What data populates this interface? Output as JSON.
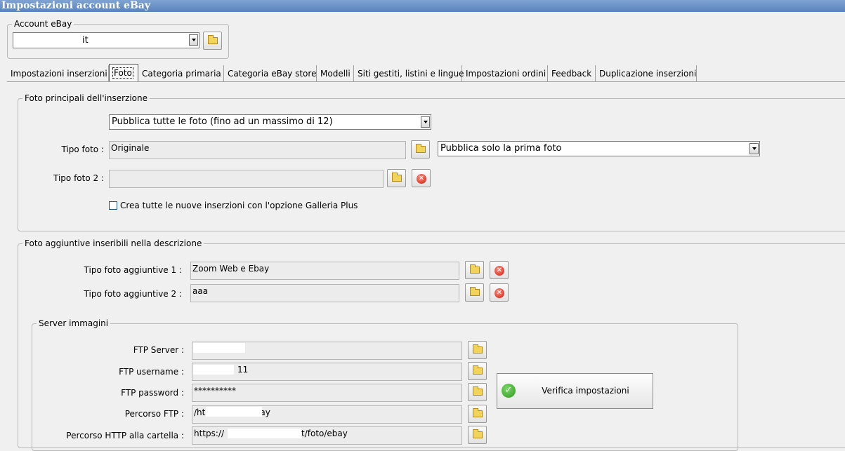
{
  "window": {
    "title": "Impostazioni account eBay"
  },
  "account": {
    "group_label": "Account eBay",
    "selected": "it"
  },
  "tabs": [
    {
      "label": "Impostazioni inserzioni"
    },
    {
      "label": "Foto"
    },
    {
      "label": "Categoria primaria"
    },
    {
      "label": "Categoria eBay store"
    },
    {
      "label": "Modelli"
    },
    {
      "label": "Siti gestiti, listini e lingue"
    },
    {
      "label": "Impostazioni ordini"
    },
    {
      "label": "Feedback"
    },
    {
      "label": "Duplicazione inserzioni"
    }
  ],
  "active_tab": "Foto",
  "main_photos": {
    "group_label": "Foto principali dell'inserzione",
    "publish_mode": "Pubblica tutte le foto (fino ad un massimo di 12)",
    "photo_type_label": "Tipo foto :",
    "photo_type_value": "Originale",
    "photo_type_publish": "Pubblica solo la prima foto",
    "photo_type2_label": "Tipo foto 2 :",
    "photo_type2_value": "",
    "gallery_plus_label": "Crea tutte le nuove inserzioni con l'opzione Galleria Plus",
    "gallery_plus_checked": false
  },
  "extra_photos": {
    "group_label": "Foto aggiuntive inseribili nella descrizione",
    "type1_label": "Tipo foto aggiuntive 1 :",
    "type1_value": "Zoom Web e Ebay",
    "type2_label": "Tipo foto aggiuntive 2 :",
    "type2_value": "aaa"
  },
  "image_server": {
    "group_label": "Server immagini",
    "ftp_server_label": "FTP Server :",
    "ftp_server_value": "",
    "ftp_username_label": "FTP username :",
    "ftp_username_value": "11",
    "ftp_password_label": "FTP password :",
    "ftp_password_value": "**********",
    "ftp_path_label": "Percorso FTP :",
    "ftp_path_value_start": "/ht",
    "ftp_path_value_end": "ay",
    "http_path_label": "Percorso HTTP alla cartella :",
    "http_path_value_start": "https://",
    "http_path_value_end": "t/foto/ebay",
    "verify_button": "Verifica impostazioni"
  },
  "icons": {
    "folder": "folder-icon",
    "delete": "delete-icon",
    "check": "check-icon",
    "dropdown": "chevron-down-icon"
  },
  "colors": {
    "titlebar": "#5b84bd",
    "delete": "#d01e10",
    "check": "#2a9a1c",
    "folder": "#f2d45b"
  }
}
